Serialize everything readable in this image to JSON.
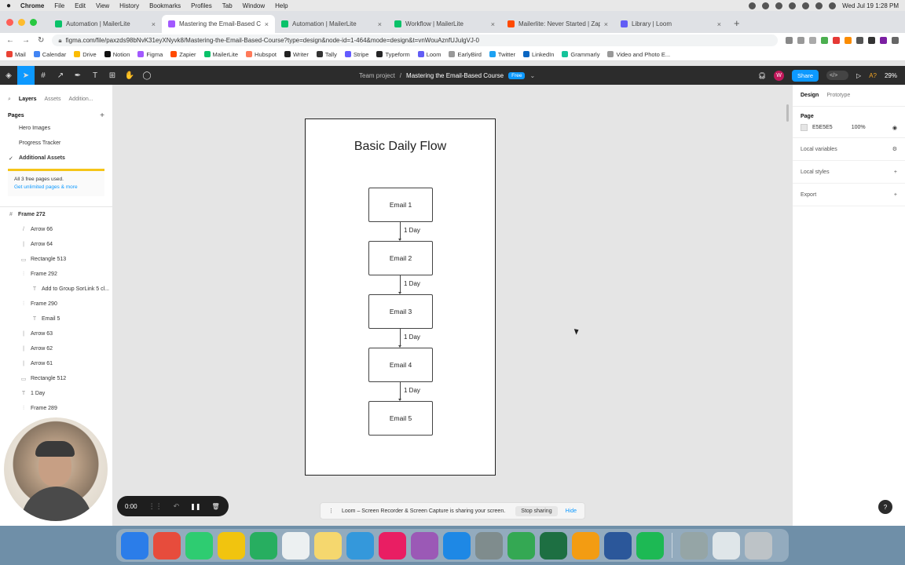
{
  "menubar": {
    "app": "Chrome",
    "items": [
      "File",
      "Edit",
      "View",
      "History",
      "Bookmarks",
      "Profiles",
      "Tab",
      "Window",
      "Help"
    ],
    "clock": "Wed Jul 19  1:28 PM"
  },
  "tabs": [
    {
      "title": "Automation | MailerLite",
      "color": "#09c269"
    },
    {
      "title": "Mastering the Email-Based Course",
      "color": "#a259ff",
      "active": true
    },
    {
      "title": "Automation | MailerLite",
      "color": "#09c269"
    },
    {
      "title": "Workflow | MailerLite",
      "color": "#09c269"
    },
    {
      "title": "Mailerlite: Never Started | Zap",
      "color": "#ff4a00"
    },
    {
      "title": "Library | Loom",
      "color": "#625df5"
    }
  ],
  "address": {
    "url": "figma.com/file/paxzds98bNvK31eyXNyvk8/Mastering-the-Email-Based-Course?type=design&node-id=1-464&mode=design&t=vnWouAznfUJulgVJ-0"
  },
  "bookmarks": [
    "Mail",
    "Calendar",
    "Drive",
    "Notion",
    "Figma",
    "Zapier",
    "MailerLite",
    "Hubspot",
    "Writer",
    "Tally",
    "Stripe",
    "Typeform",
    "Loom",
    "EarlyBird",
    "Twitter",
    "LinkedIn",
    "Grammarly",
    "Video and Photo E..."
  ],
  "figma": {
    "project": "Team project",
    "file": "Mastering the Email-Based Course",
    "plan_badge": "Free",
    "avatar": "W",
    "share": "Share",
    "zoom": "29%",
    "collab_hint": "A?"
  },
  "left_panel": {
    "tabs": [
      "Layers",
      "Assets",
      "Addition..."
    ],
    "pages_title": "Pages",
    "pages": [
      "Hero Images",
      "Progress Tracker",
      "Additional Assets"
    ],
    "notice_line1": "All 3 free pages used.",
    "notice_link": "Get unlimited pages & more",
    "layers": [
      {
        "name": "Frame 272",
        "level": 0,
        "glyph": "#"
      },
      {
        "name": "Arrow 66",
        "level": 1,
        "glyph": "/"
      },
      {
        "name": "Arrow 64",
        "level": 1,
        "glyph": "|"
      },
      {
        "name": "Rectangle 513",
        "level": 1,
        "glyph": "▭"
      },
      {
        "name": "Frame 292",
        "level": 1,
        "glyph": "⫶"
      },
      {
        "name": "Add to Group SorLink 5 cl...",
        "level": 2,
        "glyph": "T"
      },
      {
        "name": "Frame 290",
        "level": 1,
        "glyph": "⫶"
      },
      {
        "name": "Email 5",
        "level": 2,
        "glyph": "T"
      },
      {
        "name": "Arrow 63",
        "level": 1,
        "glyph": "|"
      },
      {
        "name": "Arrow 62",
        "level": 1,
        "glyph": "|"
      },
      {
        "name": "Arrow 61",
        "level": 1,
        "glyph": "|"
      },
      {
        "name": "Rectangle 512",
        "level": 1,
        "glyph": "▭"
      },
      {
        "name": "1 Day",
        "level": 1,
        "glyph": "T"
      },
      {
        "name": "Frame 289",
        "level": 1,
        "glyph": "⫶"
      }
    ]
  },
  "right_panel": {
    "tabs": [
      "Design",
      "Prototype"
    ],
    "page_title": "Page",
    "bg_hex": "E5E5E5",
    "bg_opacity": "100%",
    "rows": [
      "Local variables",
      "Local styles",
      "Export"
    ]
  },
  "artboard": {
    "title": "Basic Daily Flow",
    "emails": [
      "Email 1",
      "Email 2",
      "Email 3",
      "Email 4",
      "Email 5"
    ],
    "gap_label": "1 Day"
  },
  "loom": {
    "timer": "0:00",
    "banner": "Loom – Screen Recorder & Screen Capture is sharing your screen.",
    "stop": "Stop sharing",
    "hide": "Hide"
  },
  "help": "?",
  "dock_colors": [
    "#2b7de9",
    "#e74c3c",
    "#2ecc71",
    "#f1c40f",
    "#27ae60",
    "#ecf0f1",
    "#f5d76e",
    "#3498db",
    "#e91e63",
    "#9b59b6",
    "#1e88e5",
    "#7f8c8d",
    "#34a853",
    "#1d6f42",
    "#f39c12",
    "#2b579a",
    "#1db954",
    "#95a5a6",
    "#dfe6e9",
    "#bdc3c7"
  ]
}
